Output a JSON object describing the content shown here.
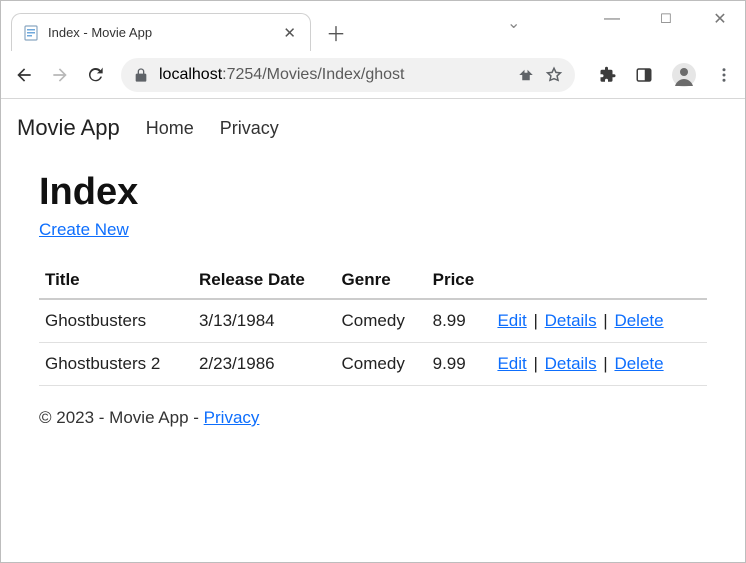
{
  "browser": {
    "tab_title": "Index - Movie App",
    "url_host": "localhost",
    "url_path": ":7254/Movies/Index/ghost"
  },
  "appbar": {
    "brand": "Movie App",
    "links": {
      "home": "Home",
      "privacy": "Privacy"
    }
  },
  "page": {
    "title": "Index",
    "create_label": "Create New",
    "headers": {
      "title": "Title",
      "release": "Release Date",
      "genre": "Genre",
      "price": "Price"
    },
    "actions": {
      "edit": "Edit",
      "details": "Details",
      "delete": "Delete"
    },
    "rows": [
      {
        "title": "Ghostbusters",
        "release": "3/13/1984",
        "genre": "Comedy",
        "price": "8.99"
      },
      {
        "title": "Ghostbusters 2",
        "release": "2/23/1986",
        "genre": "Comedy",
        "price": "9.99"
      }
    ]
  },
  "footer": {
    "text": "© 2023 - Movie App - ",
    "privacy": "Privacy"
  }
}
